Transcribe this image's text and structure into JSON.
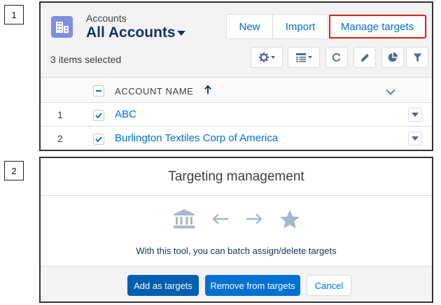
{
  "steps": [
    "1",
    "2"
  ],
  "list_view": {
    "object_label": "Accounts",
    "view_name": "All Accounts",
    "buttons": {
      "new": "New",
      "import": "Import",
      "manage_targets": "Manage targets"
    },
    "selected_count_text": "3 items selected",
    "toolbar_icons": [
      "gear-icon",
      "table-view-icon",
      "refresh-icon",
      "edit-icon",
      "chart-icon",
      "filter-icon"
    ],
    "column_header": "ACCOUNT NAME",
    "rows": [
      {
        "num": "1",
        "name": "ABC",
        "checked": true
      },
      {
        "num": "2",
        "name": "Burlington Textiles Corp of America",
        "checked": true
      }
    ],
    "colors": {
      "brand": "#0070d2",
      "header_bg": "#f3f3f5",
      "icon_bg": "#7f8de1",
      "highlight": "#e0231c"
    }
  },
  "modal": {
    "title": "Targeting management",
    "icons": [
      "bank-icon",
      "arrow-left-icon",
      "arrow-right-icon",
      "star-icon"
    ],
    "description": "With this tool, you can batch assign/delete targets",
    "buttons": {
      "add": "Add as targets",
      "remove": "Remove from targets",
      "cancel": "Cancel"
    }
  }
}
